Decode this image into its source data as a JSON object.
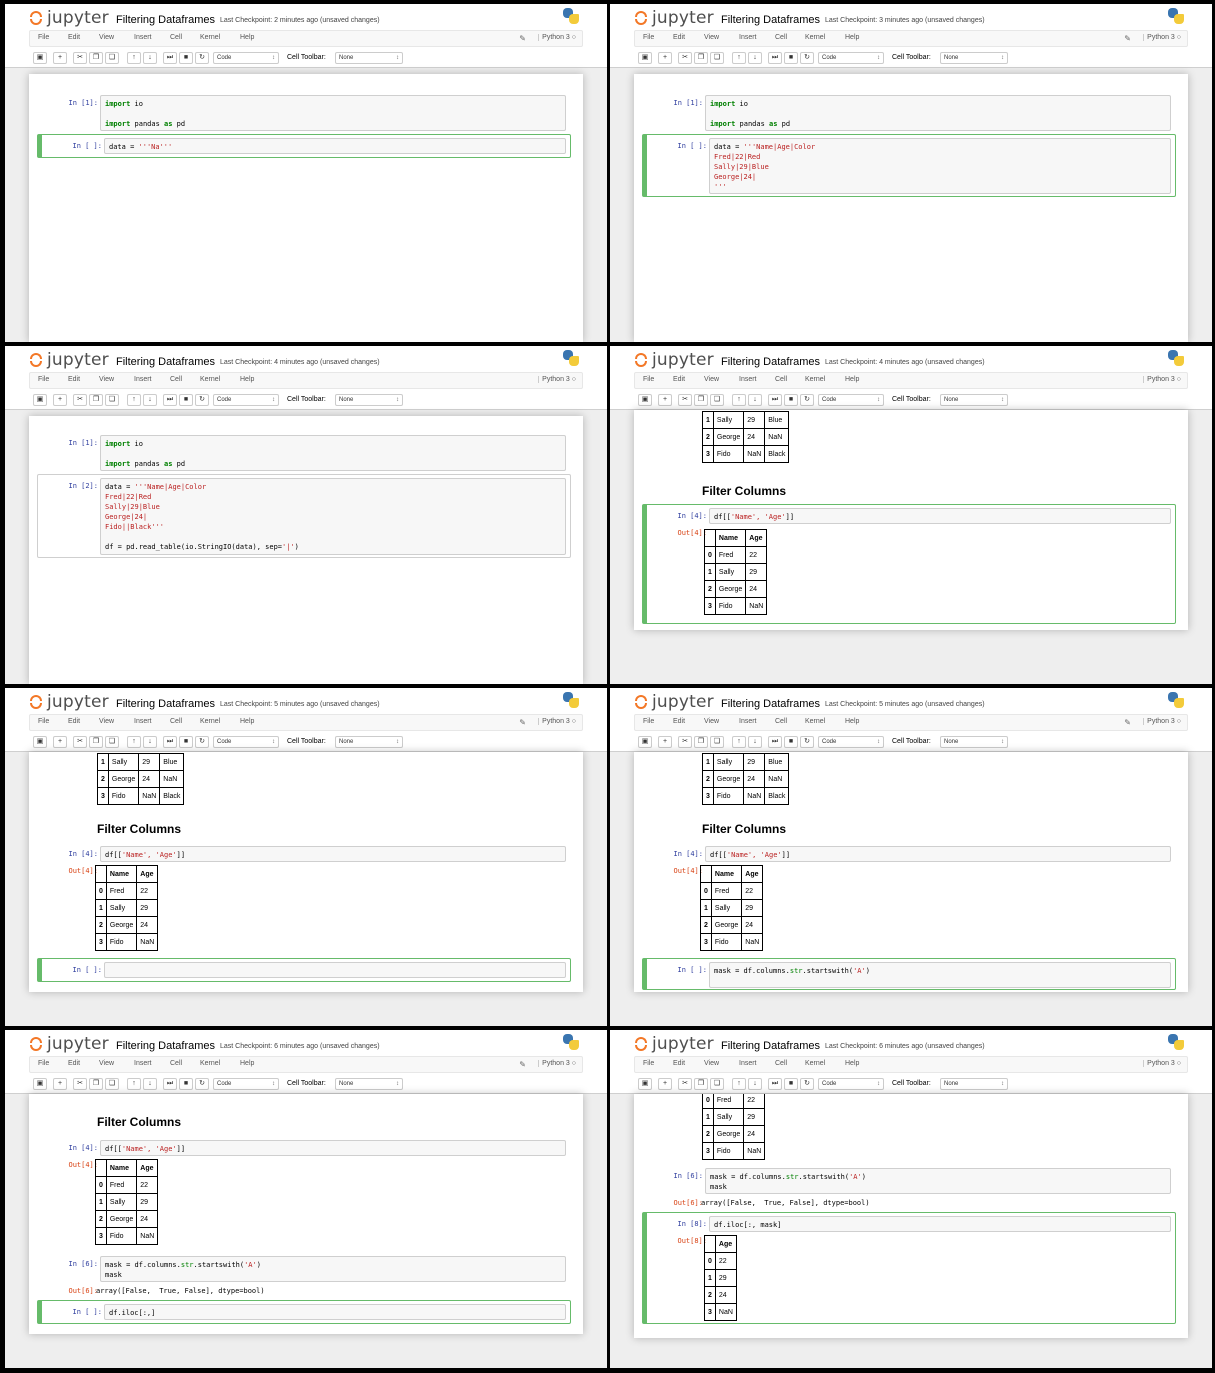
{
  "app": {
    "logo": "jupyter",
    "notebook_title": "Filtering Dataframes",
    "menu": [
      "File",
      "Edit",
      "View",
      "Insert",
      "Cell",
      "Kernel",
      "Help"
    ],
    "kernel": "Python 3",
    "cell_type": "Code",
    "cell_toolbar_label": "Cell Toolbar:",
    "cell_toolbar_value": "None"
  },
  "panels": [
    {
      "checkpoint": "Last Checkpoint: 2 minutes ago (unsaved changes)"
    },
    {
      "checkpoint": "Last Checkpoint: 3 minutes ago (unsaved changes)"
    },
    {
      "checkpoint": "Last Checkpoint: 4 minutes ago (unsaved changes)"
    },
    {
      "checkpoint": "Last Checkpoint: 4 minutes ago (unsaved changes)"
    },
    {
      "checkpoint": "Last Checkpoint: 5 minutes ago (unsaved changes)"
    },
    {
      "checkpoint": "Last Checkpoint: 5 minutes ago (unsaved changes)"
    },
    {
      "checkpoint": "Last Checkpoint: 6 minutes ago (unsaved changes)"
    },
    {
      "checkpoint": "Last Checkpoint: 6 minutes ago (unsaved changes)"
    }
  ],
  "prompts": {
    "in1": "In [1]:",
    "in2": "In [2]:",
    "in4": "In [4]:",
    "out4": "Out[4]:",
    "in6": "In [6]:",
    "out6": "Out[6]:",
    "in8": "In [8]:",
    "out8": "Out[8]:",
    "in_empty": "In [ ]:"
  },
  "code": {
    "import_io_kw": "import",
    "import_io": " io",
    "import_pd_kw": "import",
    "import_pd_mid": " pandas ",
    "import_pd_as": "as",
    "import_pd_end": " pd",
    "data_partial_prefix": "data = ",
    "data_partial_str": "'''Na",
    "data_partial_end": "'''",
    "data_prefix": "data = ",
    "data_line1": "'''Name|Age|Color",
    "data_line2": "Fred|22|Red",
    "data_line3": "Sally|29|Blue",
    "data_line4": "George|24|",
    "data_line5_partial": "'''",
    "data_line5": "Fido||Black'''",
    "read_table": "df = pd.read_table(io.StringIO(data), sep=",
    "read_table_sep": "'|'",
    "read_table_end": ")",
    "filter_cols_pre": "df[[",
    "filter_cols_str": "'Name', 'Age'",
    "filter_cols_end": "]]",
    "mask_pre": "mask = df.columns.",
    "mask_str_attr": "str",
    "mask_mid": ".startswith(",
    "mask_arg": "'A'",
    "mask_end": ")",
    "mask_line2": "mask",
    "mask_result": "array([False,  True, False], dtype=bool)",
    "iloc_partial": "df.iloc[:,]",
    "iloc_full": "df.iloc[:, mask]"
  },
  "section_heading": "Filter Columns",
  "table_full_partial": {
    "rows": [
      [
        "1",
        "Sally",
        "29",
        "Blue"
      ],
      [
        "2",
        "George",
        "24",
        "NaN"
      ],
      [
        "3",
        "Fido",
        "NaN",
        "Black"
      ]
    ]
  },
  "table_name_age": {
    "headers": [
      "",
      "Name",
      "Age"
    ],
    "rows": [
      [
        "0",
        "Fred",
        "22"
      ],
      [
        "1",
        "Sally",
        "29"
      ],
      [
        "2",
        "George",
        "24"
      ],
      [
        "3",
        "Fido",
        "NaN"
      ]
    ]
  },
  "table_age": {
    "headers": [
      "",
      "Age"
    ],
    "rows": [
      [
        "0",
        "22"
      ],
      [
        "1",
        "29"
      ],
      [
        "2",
        "24"
      ],
      [
        "3",
        "NaN"
      ]
    ]
  },
  "table_name_age_partial": {
    "rows": [
      [
        "0",
        "Fred",
        "22"
      ],
      [
        "1",
        "Sally",
        "29"
      ],
      [
        "2",
        "George",
        "24"
      ],
      [
        "3",
        "Fido",
        "NaN"
      ]
    ]
  }
}
